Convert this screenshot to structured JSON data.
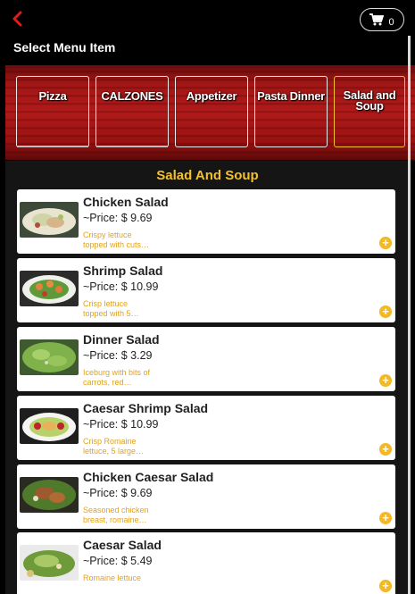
{
  "header": {
    "back_icon": "chevron-left-icon",
    "cart_icon": "shopping-cart-icon",
    "cart_count": "0",
    "accent_color": "#e01b1b"
  },
  "page": {
    "section_title": "Select Menu Item"
  },
  "categories": [
    {
      "label": "Pizza",
      "active": false
    },
    {
      "label": "CALZONES",
      "active": false
    },
    {
      "label": "Appetizer",
      "active": false
    },
    {
      "label": "Pasta Dinner",
      "active": false
    },
    {
      "label": "Salad and Soup",
      "active": true
    }
  ],
  "current_category": {
    "heading": "Salad And Soup",
    "heading_color": "#f3c22a"
  },
  "items": [
    {
      "name": "Chicken Salad",
      "price": "~Price: $ 9.69",
      "desc": "Crispy lettuce topped with cuts…",
      "photo": "chicken-salad-photo"
    },
    {
      "name": "Shrimp Salad",
      "price": "~Price: $ 10.99",
      "desc": "Crisp lettuce topped with 5…",
      "photo": "shrimp-salad-photo"
    },
    {
      "name": "Dinner Salad",
      "price": "~Price: $ 3.29",
      "desc": "Iceburg with bits of carrots, red…",
      "photo": "dinner-salad-photo"
    },
    {
      "name": "Caesar Shrimp Salad",
      "price": "~Price: $ 10.99",
      "desc": "Crisp Romaine lettuce, 5 large…",
      "photo": "caesar-shrimp-salad-photo"
    },
    {
      "name": "Chicken Caesar Salad",
      "price": "~Price: $ 9.69",
      "desc": "Seasoned chicken breast, romaine…",
      "photo": "chicken-caesar-salad-photo"
    },
    {
      "name": "Caesar Salad",
      "price": "~Price: $ 5.49",
      "desc": "Romaine lettuce",
      "photo": "caesar-salad-photo"
    }
  ]
}
